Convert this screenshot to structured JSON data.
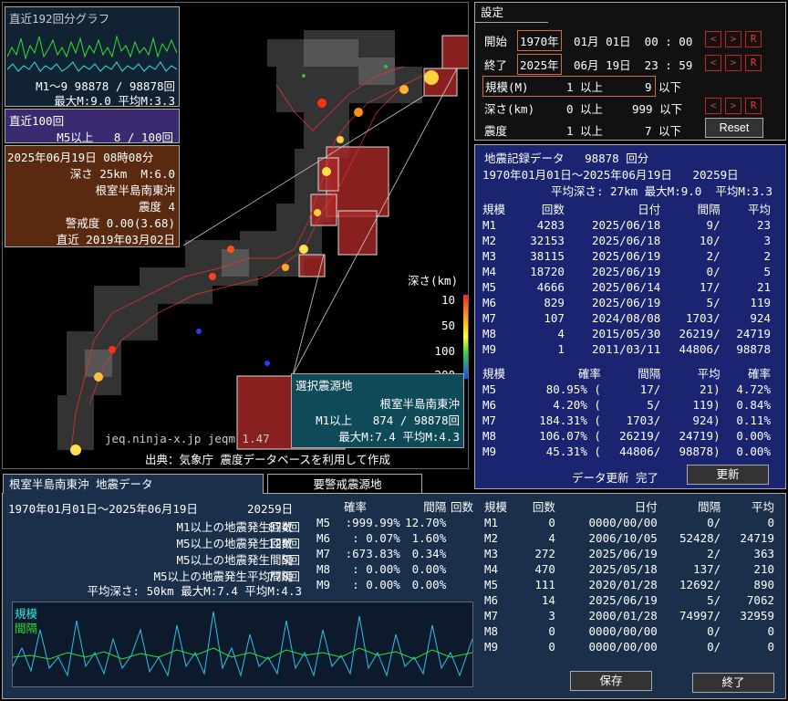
{
  "spark": {
    "title": "直近192回分グラフ",
    "line1": "M1～9 98878 / 98878回",
    "line2": "最大M:9.0 平均M:3.3"
  },
  "recent100": {
    "title": "直近100回",
    "line": "M5以上   8 / 100回"
  },
  "latest": {
    "datetime": "2025年06月19日 08時08分",
    "depth": "深さ 25km  M:6.0",
    "place": "根室半島南東沖",
    "intensity": "震度 4",
    "alert": "警戒度 0.00(3.68)",
    "last": "直近 2019年03月02日"
  },
  "legend": {
    "title": "深さ(km)",
    "t1": "10",
    "t2": "50",
    "t3": "100",
    "t4": "200"
  },
  "credit": {
    "site": "jeq.ninja-x.jp jeqm 1.47",
    "source": "出典：気象庁 震度データベースを利用して作成"
  },
  "selected": {
    "title": "選択震源地",
    "place": "根室半島南東沖",
    "line1": "M1以上   874 / 98878回",
    "line2": "最大M:7.4 平均M:4.3"
  },
  "settings": {
    "title": "設定",
    "start_label": "開始",
    "start_year": "1970年",
    "start_rest": "01月 01日  00 : 00",
    "end_label": "終了",
    "end_year": "2025年",
    "end_rest": "06月 19日  23 : 59",
    "scale_label": "規模(M)",
    "scale_min": "1 以上",
    "scale_max": "9 以下",
    "depth_label": "深さ(km)",
    "depth_min": "0 以上",
    "depth_max": "999 以下",
    "int_label": "震度",
    "int_min": "1 以上",
    "int_max": "7 以下",
    "prev": "<",
    "next": ">",
    "reset_r": "R",
    "reset": "Reset"
  },
  "records": {
    "title": "地震記録データ   98878 回分",
    "range": "1970年01月01日～2025年06月19日   20259日",
    "avg": "平均深さ: 27km 最大M:9.0  平均M:3.3",
    "head1": [
      "規模",
      "回数",
      "日付",
      "間隔",
      "平均"
    ],
    "rows1": [
      [
        "M1",
        "4283",
        "2025/06/18",
        "9/",
        "23"
      ],
      [
        "M2",
        "32153",
        "2025/06/18",
        "10/",
        "3"
      ],
      [
        "M3",
        "38115",
        "2025/06/19",
        "2/",
        "2"
      ],
      [
        "M4",
        "18720",
        "2025/06/19",
        "0/",
        "5"
      ],
      [
        "M5",
        "4666",
        "2025/06/14",
        "17/",
        "21"
      ],
      [
        "M6",
        "829",
        "2025/06/19",
        "5/",
        "119"
      ],
      [
        "M7",
        "107",
        "2024/08/08",
        "1703/",
        "924"
      ],
      [
        "M8",
        "4",
        "2015/05/30",
        "26219/",
        "24719"
      ],
      [
        "M9",
        "1",
        "2011/03/11",
        "44806/",
        "98878"
      ]
    ],
    "head2": [
      "規模",
      "確率",
      "間隔",
      "平均",
      "確率"
    ],
    "rows2": [
      [
        "M5",
        "80.95% (",
        "17/",
        "21)",
        "4.72%"
      ],
      [
        "M6",
        "4.20% (",
        "5/",
        "119)",
        "0.84%"
      ],
      [
        "M7",
        "184.31% (",
        "1703/",
        "924)",
        "0.11%"
      ],
      [
        "M8",
        "106.07% (",
        "26219/",
        "24719)",
        "0.00%"
      ],
      [
        "M9",
        "45.31% (",
        "44806/",
        "98878)",
        "0.00%"
      ]
    ],
    "update_status": "データ更新 完了",
    "update": "更新"
  },
  "bottom": {
    "tab1": "根室半島南東沖 地震データ",
    "tab2": "要警戒震源地",
    "range": "1970年01月01日～2025年06月19日",
    "days": "20259日",
    "labels": [
      "M1以上の地震発生回数",
      "M5以上の地震発生回数",
      "M5以上の地震発生間隔",
      "M5以上の地震発生平均間隔"
    ],
    "values": [
      "874回",
      "128回",
      "5回",
      "778回"
    ],
    "avgline": "平均深さ: 50km 最大M:7.4 平均M:4.3",
    "probhead": [
      "確率",
      "間隔",
      "回数"
    ],
    "probrows": [
      [
        "M5",
        ":999.99%",
        "12.70%"
      ],
      [
        "M6",
        ":  0.07%",
        "1.60%"
      ],
      [
        "M7",
        ":673.83%",
        "0.34%"
      ],
      [
        "M8",
        ":  0.00%",
        "0.00%"
      ],
      [
        "M9",
        ":  0.00%",
        "0.00%"
      ]
    ],
    "graph_l1": "規模",
    "graph_l2": "間隔",
    "head": [
      "規模",
      "回数",
      "日付",
      "間隔",
      "平均"
    ],
    "rows": [
      [
        "M1",
        "0",
        "0000/00/00",
        "0/",
        "0"
      ],
      [
        "M2",
        "4",
        "2006/10/05",
        "52428/",
        "24719"
      ],
      [
        "M3",
        "272",
        "2025/06/19",
        "2/",
        "363"
      ],
      [
        "M4",
        "470",
        "2025/05/18",
        "137/",
        "210"
      ],
      [
        "M5",
        "111",
        "2020/01/28",
        "12692/",
        "890"
      ],
      [
        "M6",
        "14",
        "2025/06/19",
        "5/",
        "7062"
      ],
      [
        "M7",
        "3",
        "2000/01/28",
        "74997/",
        "32959"
      ],
      [
        "M8",
        "0",
        "0000/00/00",
        "0/",
        "0"
      ],
      [
        "M9",
        "0",
        "0000/00/00",
        "0/",
        "0"
      ]
    ],
    "save": "保存",
    "quit": "終了"
  },
  "colors": {
    "accent": "#e05030",
    "navy": "#1a2470",
    "teal": "#0f4a58",
    "brown": "#5a2a10"
  }
}
